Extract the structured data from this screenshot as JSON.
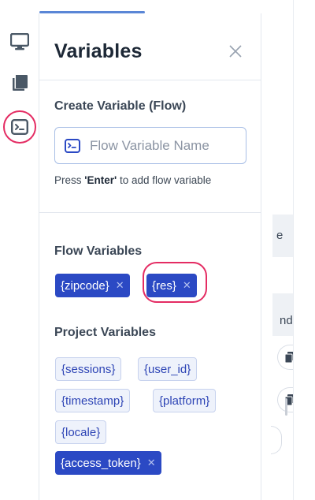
{
  "panel": {
    "title": "Variables",
    "create_section_label": "Create Variable (Flow)",
    "name_input": {
      "placeholder": "Flow Variable Name",
      "value": ""
    },
    "hint": {
      "prefix": "Press ",
      "key": "'Enter'",
      "suffix": " to add flow variable"
    },
    "flow_section_label": "Flow Variables",
    "flow_variables": [
      {
        "label": "{zipcode}",
        "remove": "✕"
      },
      {
        "label": "{res}",
        "remove": "✕"
      }
    ],
    "project_section_label": "Project Variables",
    "project_variables": [
      {
        "label": "{sessions}"
      },
      {
        "label": "{user_id}"
      },
      {
        "label": "{timestamp}"
      },
      {
        "label": "{platform}"
      },
      {
        "label": "{locale}"
      },
      {
        "label": "{access_token}",
        "remove": "✕"
      }
    ]
  },
  "rail": {
    "items": [
      {
        "icon": "monitor-icon"
      },
      {
        "icon": "book-icon"
      },
      {
        "icon": "terminal-icon",
        "active": true
      }
    ]
  },
  "background": {
    "partial_text_1": "e",
    "partial_text_2": "nd"
  },
  "colors": {
    "accent": "#2b49c4",
    "highlight": "#e42c63",
    "rail_icon": "#4a5866"
  }
}
